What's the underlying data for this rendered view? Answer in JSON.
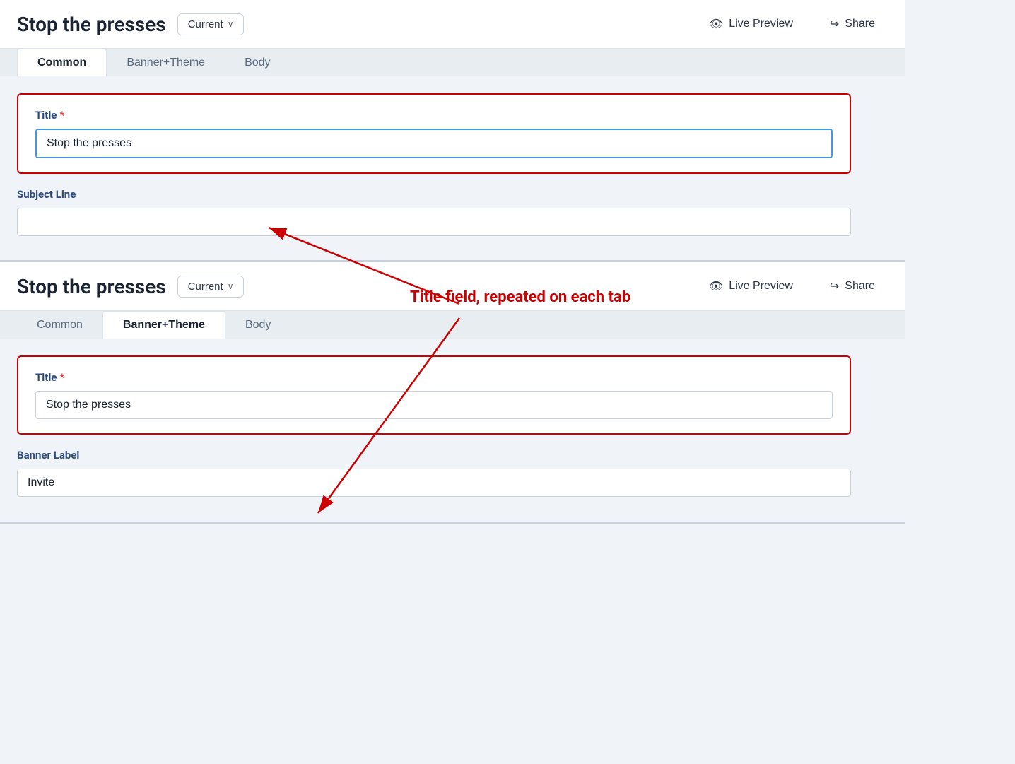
{
  "page": {
    "title": "Stop the presses"
  },
  "top_panel": {
    "title": "Stop the presses",
    "version_label": "Current",
    "live_preview_label": "Live Preview",
    "share_label": "Share",
    "tabs": [
      {
        "id": "common",
        "label": "Common",
        "active": true
      },
      {
        "id": "banner_theme",
        "label": "Banner+Theme",
        "active": false
      },
      {
        "id": "body",
        "label": "Body",
        "active": false
      }
    ],
    "title_field": {
      "label": "Title",
      "required": true,
      "value": "Stop the presses"
    },
    "subject_line_field": {
      "label": "Subject Line",
      "value": ""
    }
  },
  "bottom_panel": {
    "title": "Stop the presses",
    "version_label": "Current",
    "live_preview_label": "Live Preview",
    "share_label": "Share",
    "tabs": [
      {
        "id": "common",
        "label": "Common",
        "active": false
      },
      {
        "id": "banner_theme",
        "label": "Banner+Theme",
        "active": true
      },
      {
        "id": "body",
        "label": "Body",
        "active": false
      }
    ],
    "title_field": {
      "label": "Title",
      "required": true,
      "value": "Stop the presses"
    },
    "banner_label_field": {
      "label": "Banner Label",
      "value": "Invite"
    }
  },
  "annotation": {
    "text": "Title field, repeated on each tab"
  },
  "icons": {
    "eye": "👁",
    "share": "↪",
    "chevron": "∨"
  }
}
